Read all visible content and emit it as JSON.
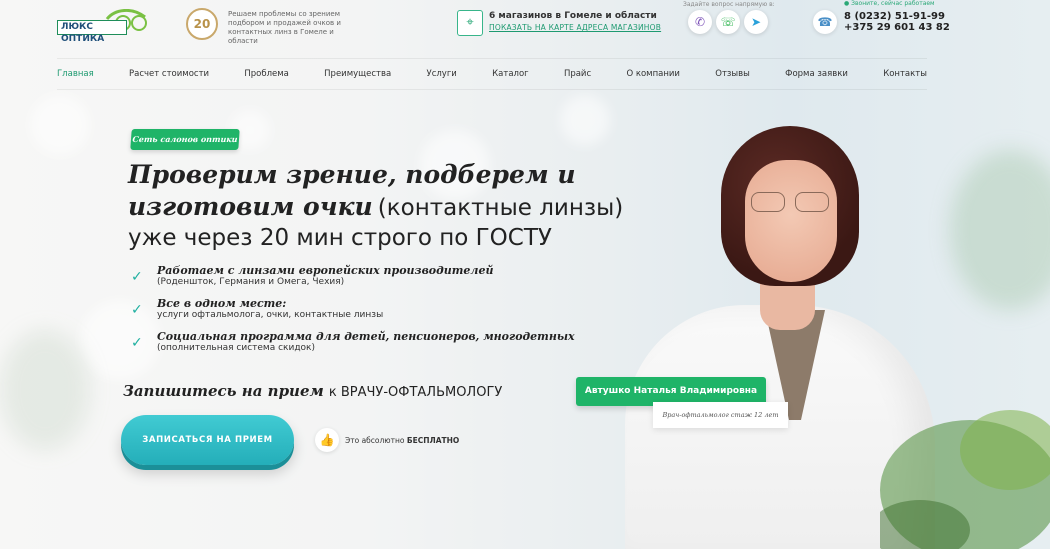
{
  "brand": {
    "logo_text": "ЛЮКС ОПТИКА",
    "years_badge": "20",
    "tagline": "Решаем проблемы со зрением подбором и продажей очков и контактных линз в Гомеле и области"
  },
  "stores": {
    "title": "6 магазинов в Гомеле и области",
    "link": "ПОКАЗАТЬ НА КАРТЕ АДРЕСА МАГАЗИНОВ"
  },
  "contacts": {
    "ask_label": "Задайте вопрос напрямую в:",
    "call_status": "● Звоните, сейчас работаем",
    "phone1": "8 (0232) 51-91-99",
    "phone2": "+375 29 601 43 82",
    "messengers": [
      "viber-icon",
      "whatsapp-icon",
      "telegram-icon"
    ]
  },
  "nav": [
    "Главная",
    "Расчет стоимости",
    "Проблема",
    "Преимущества",
    "Услуги",
    "Каталог",
    "Прайс",
    "О компании",
    "Отзывы",
    "Форма заявки",
    "Контакты"
  ],
  "hero": {
    "pill": "Сеть салонов оптики",
    "h1_bold": "Проверим зрение, подберем и изготовим очки",
    "h1_light_a": "(контактные линзы)",
    "h1_light_b": "уже через 20 мин строго по ГОСТУ",
    "features": [
      {
        "title": "Работаем с линзами европейских производителей",
        "sub": "(Роденшток, Германия и Омега, Чехия)"
      },
      {
        "title": "Все в одном месте:",
        "sub": "услуги офтальмолога, очки, контактные линзы"
      },
      {
        "title": "Социальная программа для детей, пенсионеров, многодетных",
        "sub": "(ополнительная система скидок)"
      }
    ],
    "cta_bold": "Запишитесь на прием",
    "cta_rest": "к ВРАЧУ-ОФТАЛЬМОЛОГУ",
    "button": "ЗАПИСАТЬСЯ НА ПРИЕМ",
    "free_prefix": "Это абсолютно",
    "free_bold": "БЕСПЛАТНО"
  },
  "doctor": {
    "name": "Автушко Наталья Владимировна",
    "role": "Врач-офтальмолог стаж 12 лет"
  },
  "colors": {
    "accent_green": "#1fb468",
    "link_green": "#1e9a71",
    "button_teal": "#2ab6c0"
  }
}
